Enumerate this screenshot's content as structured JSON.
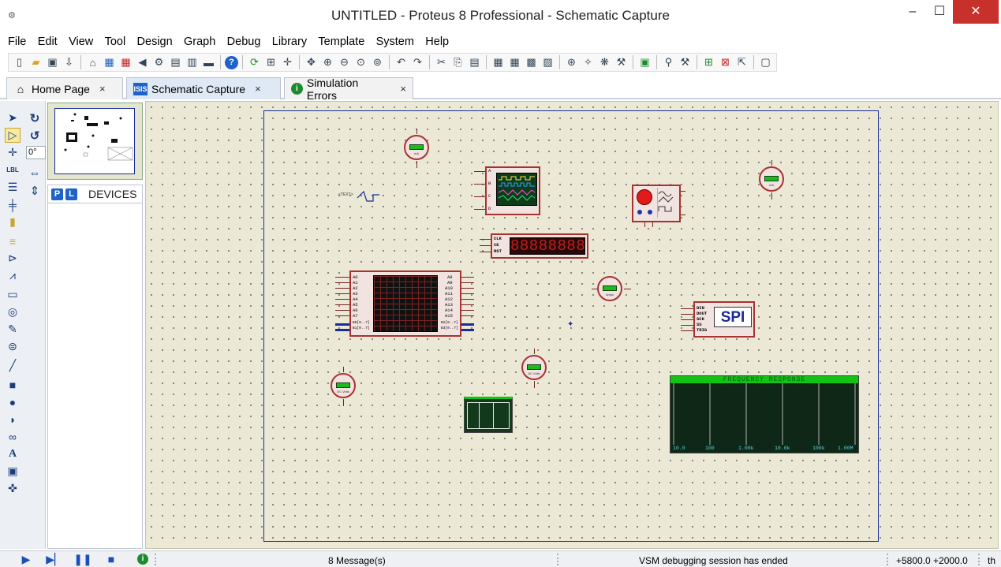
{
  "window": {
    "title": "UNTITLED - Proteus 8 Professional - Schematic Capture",
    "minimize": "–",
    "maximize": "☐",
    "close": "✕"
  },
  "menu": [
    "File",
    "Edit",
    "View",
    "Tool",
    "Design",
    "Graph",
    "Debug",
    "Library",
    "Template",
    "System",
    "Help"
  ],
  "tabs": [
    {
      "label": "Home Page",
      "icon": "home-icon",
      "close": "×"
    },
    {
      "label": "Schematic Capture",
      "icon": "isis-icon",
      "close": "×"
    },
    {
      "label": "Simulation Errors",
      "icon": "info-icon",
      "close": "×"
    }
  ],
  "left_panel": {
    "rotation_value": "0°",
    "devices_label": "DEVICES",
    "pick_button": "P",
    "library_button": "L"
  },
  "canvas": {
    "terminal_label": "<TEXT>",
    "oscilloscope_pins": [
      "A",
      "B",
      "C",
      "D"
    ],
    "counter_pins": [
      "CLK",
      "CE",
      "RST"
    ],
    "counter_display": "88888888",
    "logic_left_pins": [
      "A0",
      "A1",
      "A2",
      "A3",
      "A4",
      "A5",
      "A6",
      "A7",
      "B0[0..7]",
      "B1[0..7]"
    ],
    "logic_right_pins": [
      "A8",
      "A9",
      "A10",
      "A11",
      "A12",
      "A13",
      "A14",
      "A15",
      "B2[0..7]",
      "B3[0..7]"
    ],
    "spi_pins": [
      "DIN",
      "DOUT",
      "SCK",
      "SS",
      "TRIG"
    ],
    "spi_label": "SPI",
    "meters": {
      "top_left": "mA",
      "top_right": "mA",
      "middle": "Amps",
      "bottom_center": "AC Volts",
      "bottom_left": "DC Volts"
    },
    "freq_graph": {
      "title": "FREQUENCY RESPONSE",
      "ticks": [
        "10.0",
        "100",
        "1.00k",
        "10.0k",
        "100k",
        "1.00M"
      ]
    }
  },
  "status": {
    "messages": "8 Message(s)",
    "session": "VSM debugging session has ended",
    "coords": "+5800.0  +2000.0",
    "units": "th"
  },
  "colors": {
    "canvas_bg": "#ebe8d6",
    "component_outline": "#a83232",
    "component_fill": "#f1e3df",
    "sheet_border": "#1a2a9a",
    "graph_header": "#13c313",
    "graph_bg": "#0f2716"
  }
}
